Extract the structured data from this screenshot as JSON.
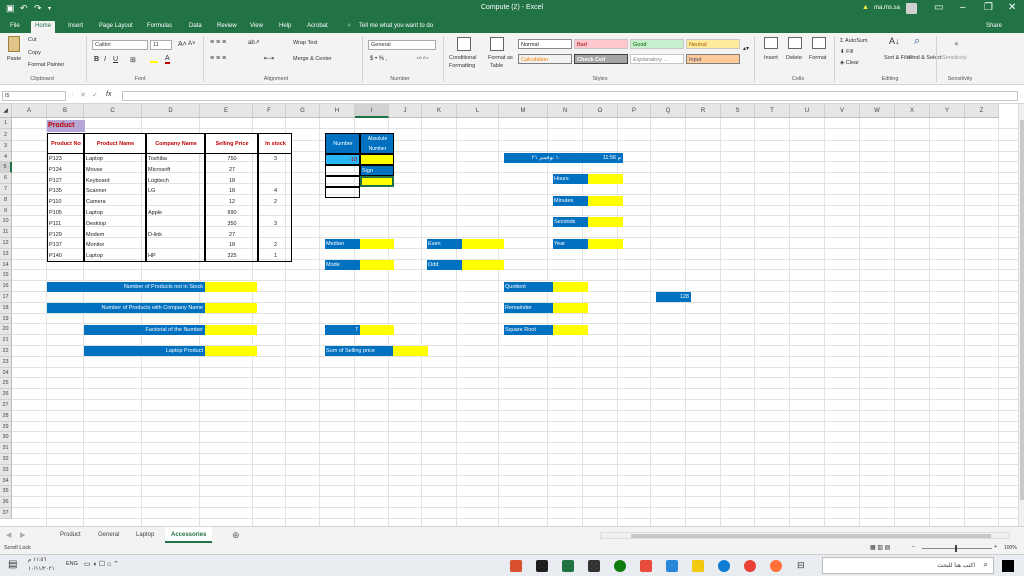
{
  "window": {
    "title": "Compute (2)  -  Excel",
    "user": "ma.ms.sa"
  },
  "tabs": [
    "File",
    "Home",
    "Insert",
    "Page Layout",
    "Formulas",
    "Data",
    "Review",
    "View",
    "Help",
    "Acrobat"
  ],
  "tell_me": "Tell me what you want to do",
  "share": "Share",
  "ribbon": {
    "cut": "Cut",
    "copy": "Copy",
    "paste": "Paste",
    "format_painter": "Format Painter",
    "font_name": "Calibri",
    "font_size": "11",
    "wrap_text": "Wrap Text",
    "merge_center": "Merge & Center",
    "number_format": "General",
    "conditional": "Conditional",
    "formatting": "Formatting",
    "format_as": "Format as",
    "table": "Table",
    "styles": {
      "normal": "Normal",
      "bad": "Bad",
      "good": "Good",
      "neutral": "Neutral",
      "calculation": "Calculation",
      "check_cell": "Check Cell",
      "explanatory": "Explanatory ...",
      "input": "Input"
    },
    "insert": "Insert",
    "delete": "Delete",
    "format": "Format",
    "autosum": "AutoSum",
    "fill": "Fill",
    "clear": "Clear",
    "sort_filter": "Sort & Filter",
    "find_select": "Find & Select",
    "sensitivity": "Sensitivity",
    "groups": {
      "clipboard": "Clipboard",
      "font": "Font",
      "alignment": "Alignment",
      "number": "Number",
      "styles": "Styles",
      "cells": "Cells",
      "editing": "Editing",
      "sensitivity": "Sensitivity"
    }
  },
  "name_box": "I5",
  "fx": "fx",
  "columns": [
    "A",
    "B",
    "C",
    "D",
    "E",
    "F",
    "G",
    "H",
    "I",
    "J",
    "K",
    "L",
    "M",
    "N",
    "O",
    "P",
    "Q",
    "R",
    "S",
    "T",
    "U",
    "V",
    "W",
    "X",
    "Y",
    "Z"
  ],
  "rows": [
    "1",
    "2",
    "3",
    "4",
    "5",
    "6",
    "7",
    "8",
    "9",
    "10",
    "11",
    "12",
    "13",
    "14",
    "15",
    "16",
    "17",
    "18",
    "19",
    "20",
    "21",
    "22",
    "23",
    "24",
    "25",
    "26",
    "27",
    "28",
    "29",
    "30",
    "31",
    "32",
    "33",
    "34",
    "35",
    "36",
    "37"
  ],
  "sheet": {
    "title": "Product",
    "headers": [
      "Product No",
      "Product Name",
      "Company Name",
      "Selling Price",
      "In stock"
    ],
    "products": [
      [
        "P123",
        "Laptop",
        "Toshiba",
        "750",
        "3"
      ],
      [
        "P124",
        "Mouse",
        "Microsoft",
        "27",
        ""
      ],
      [
        "P127",
        "Keyboard",
        "Logitech",
        "18",
        ""
      ],
      [
        "P135",
        "Scanner",
        "LG",
        "18",
        "4"
      ],
      [
        "P110",
        "Camera",
        "",
        "12",
        "2"
      ],
      [
        "P105",
        "Laptop",
        "Apple",
        "990",
        ""
      ],
      [
        "P111",
        "Desktop",
        "",
        "350",
        "3"
      ],
      [
        "P129",
        "Modem",
        "D-link",
        "27",
        ""
      ],
      [
        "P137",
        "Monitor",
        "",
        "18",
        "2"
      ],
      [
        "P140",
        "Laptop",
        "HP",
        "325",
        "1"
      ]
    ],
    "number_label": "Number",
    "absolute_label": "Absolute Number",
    "number_value": "-10",
    "sign_label": "Sign",
    "median": "Median",
    "mode": "Mode",
    "even": "Even",
    "odd": "Odd",
    "datetime": "١٠ نوفمبر ٢١",
    "time": "11:56 م",
    "hours": "Hours",
    "minutes": "Minutes",
    "seconds": "Seconds",
    "year": "Year",
    "not_in_stock": "Number of Products not in Stock",
    "with_company": "Number of Products with Company Name",
    "factorial": "Factorial of the Number",
    "factorial_num": "7",
    "laptop_product": "Laptop Product",
    "sum_selling": "Sum of Selling price",
    "quotient": "Quotient",
    "remainder": "Remainder",
    "square_root": "Square Root",
    "q_value": "128"
  },
  "sheet_tabs": [
    "Product",
    "General",
    "Laptop",
    "Accessories"
  ],
  "active_sheet": "Accessories",
  "status": {
    "left": "Scroll Lock",
    "zoom": "100%"
  },
  "taskbar": {
    "search": "اكتب هنا للبحث",
    "lang": "ENG",
    "clock": "١١:٥٦ م",
    "date": "١٠/١١/٢٠٢١"
  }
}
